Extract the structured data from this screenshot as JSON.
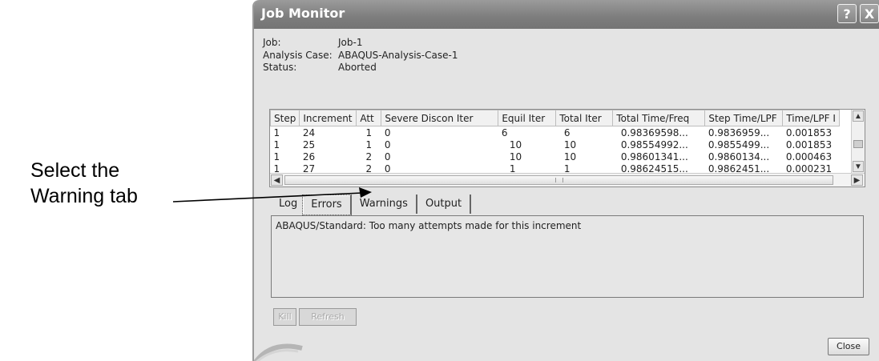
{
  "annotation": {
    "line1": "Select the",
    "line2": "Warning tab"
  },
  "window": {
    "title": "Job Monitor",
    "help_label": "?",
    "close_label": "X"
  },
  "info": {
    "job_label": "Job:",
    "job_value": "Job-1",
    "case_label": "Analysis Case:",
    "case_value": "ABAQUS-Analysis-Case-1",
    "status_label": "Status:",
    "status_value": "Aborted"
  },
  "table": {
    "columns": [
      "Step",
      "Increment",
      "Att",
      "Severe Discon Iter",
      "Equil Iter",
      "Total Iter",
      "Total Time/Freq",
      "Step Time/LPF",
      "Time/LPF I"
    ],
    "rows": [
      [
        "1",
        "24",
        "1",
        "0",
        "6",
        "6",
        "0.98369598...",
        "0.9836959...",
        "0.001853"
      ],
      [
        "1",
        "25",
        "1",
        "0",
        "10",
        "10",
        "0.98554992...",
        "0.9855499...",
        "0.001853"
      ],
      [
        "1",
        "26",
        "2",
        "0",
        "10",
        "10",
        "0.98601341...",
        "0.9860134...",
        "0.000463"
      ],
      [
        "1",
        "27",
        "2",
        "0",
        "1",
        "1",
        "0.98624515...",
        "0.9862451...",
        "0.000231"
      ]
    ]
  },
  "tabs": [
    "Log",
    "Errors",
    "Warnings",
    "Output"
  ],
  "selected_tab": "Errors",
  "log_text": "ABAQUS/Standard: Too many attempts made for this increment",
  "buttons": {
    "kill": "Kill",
    "refresh": "Refresh",
    "close": "Close"
  }
}
